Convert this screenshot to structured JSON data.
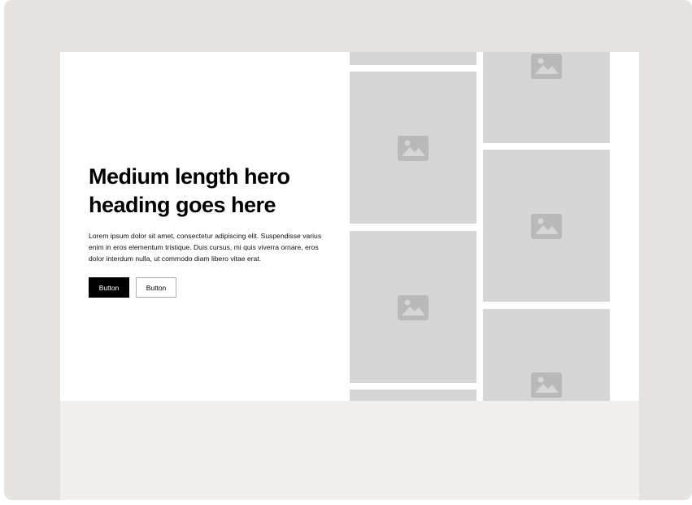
{
  "hero": {
    "heading": "Medium length hero heading goes here",
    "body": "Lorem ipsum dolor sit amet, consectetur adipiscing elit. Suspendisse varius enim in eros elementum tristique. Duis cursus, mi quis viverra ornare, eros dolor interdum nulla, ut commodo diam libero vitae erat.",
    "primary_button_label": "Button",
    "secondary_button_label": "Button"
  },
  "gallery": {
    "icon": "image-placeholder-icon",
    "tile_count": 8
  },
  "colors": {
    "frame_background": "#e4e3df",
    "hero_background": "#ffffff",
    "placeholder_fill": "#d6d6d6",
    "placeholder_icon": "#b9b9b9",
    "primary_button": "#000000"
  }
}
